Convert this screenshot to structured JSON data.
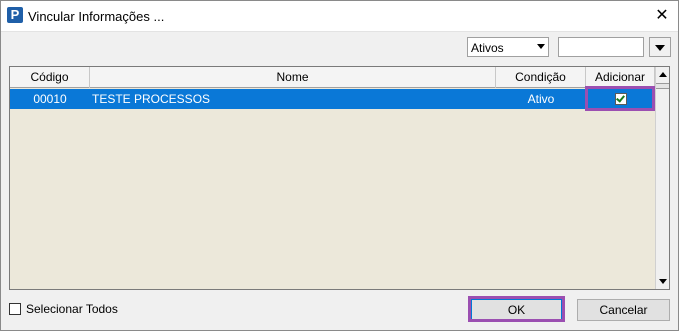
{
  "window": {
    "title": "Vincular Informações  ...",
    "close_glyph": "✕",
    "app_icon_letter": "P"
  },
  "filters": {
    "status_selected": "Ativos",
    "search_value": ""
  },
  "grid": {
    "columns": [
      "Código",
      "Nome",
      "Condição",
      "Adicionar"
    ],
    "rows": [
      {
        "codigo": "00010",
        "nome": "TESTE PROCESSOS",
        "condicao": "Ativo",
        "adicionar": true
      }
    ],
    "selected_row_color": "#0a78d7",
    "empty_bg_color": "#ece8da"
  },
  "footer": {
    "select_all_label": "Selecionar Todos",
    "ok_label": "OK",
    "cancel_label": "Cancelar"
  },
  "annotation_color": "#9b4fb1"
}
